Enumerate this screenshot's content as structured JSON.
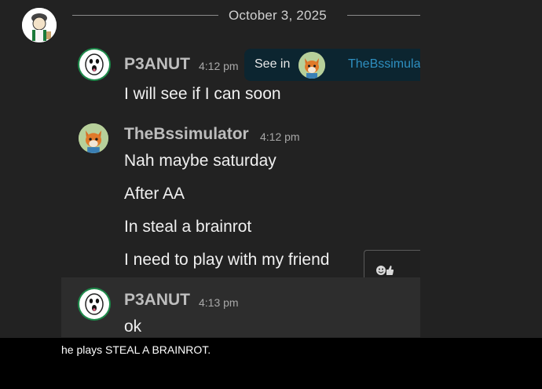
{
  "date_divider": "October 3, 2025",
  "messages": [
    {
      "user": "P3ANUT",
      "time": "4:12 pm",
      "lines": [
        "I will see if I can soon"
      ]
    },
    {
      "user": "TheBssimulator",
      "time": "4:12 pm",
      "lines": [
        "Nah maybe saturday",
        "After AA",
        "In steal a brainrot",
        "I need to play with my friend"
      ]
    },
    {
      "user": "P3ANUT",
      "time": "4:13 pm",
      "lines": [
        "ok"
      ]
    }
  ],
  "see_in": {
    "label": "See in",
    "name": "TheBssimulator"
  },
  "reaction_icon": "emoji-thumbs-up-icon",
  "caption": "he plays STEAL A BRAINROT.",
  "colors": {
    "background": "#222222",
    "link": "#2e8fc0",
    "popup": "#0c2530",
    "avatar_ring": "#1d8a4a"
  }
}
